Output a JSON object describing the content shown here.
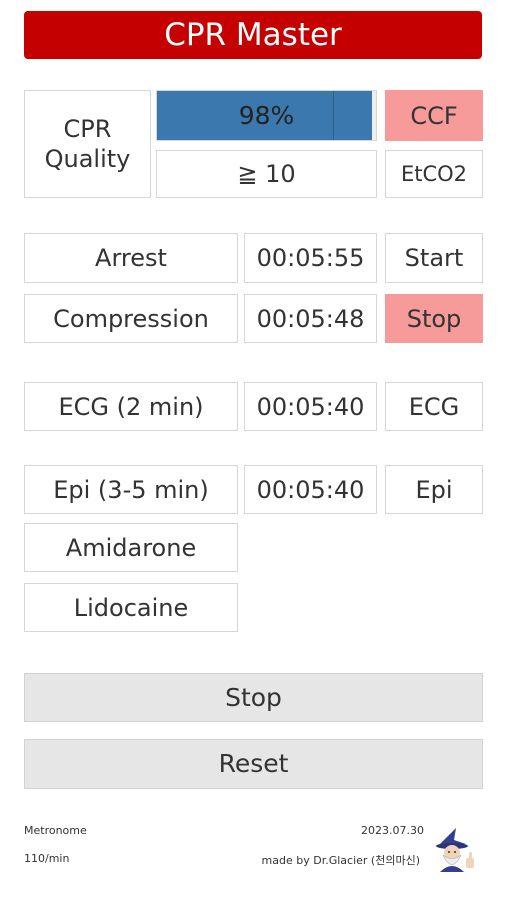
{
  "app": {
    "title": "CPR Master"
  },
  "quality": {
    "label": "CPR Quality",
    "ccf_percent": 98,
    "ccf_value": "98%",
    "ccf_button": "CCF",
    "etco2_value": "≧ 10",
    "etco2_button": "EtCO2",
    "fill_color": "#3a78ad"
  },
  "timers": {
    "arrest": {
      "label": "Arrest",
      "time": "00:05:55",
      "button": "Start"
    },
    "compression": {
      "label": "Compression",
      "time": "00:05:48",
      "button": "Stop"
    },
    "ecg": {
      "label": "ECG (2 min)",
      "time": "00:05:40",
      "button": "ECG"
    },
    "epi": {
      "label": "Epi (3-5 min)",
      "time": "00:05:40",
      "button": "Epi"
    }
  },
  "drugs": {
    "amidarone": "Amidarone",
    "lidocaine": "Lidocaine"
  },
  "controls": {
    "stop": "Stop",
    "reset": "Reset"
  },
  "footer": {
    "metronome_label": "Metronome",
    "metronome_rate": "110/min",
    "date": "2023.07.30",
    "credit": "made by Dr.Glacier (천의마신)",
    "avatar_icon": "wizard-avatar-icon"
  },
  "colors": {
    "title_bar": "#c40000",
    "active_button": "#f79a9a",
    "neutral_button": "#e6e6e6"
  }
}
